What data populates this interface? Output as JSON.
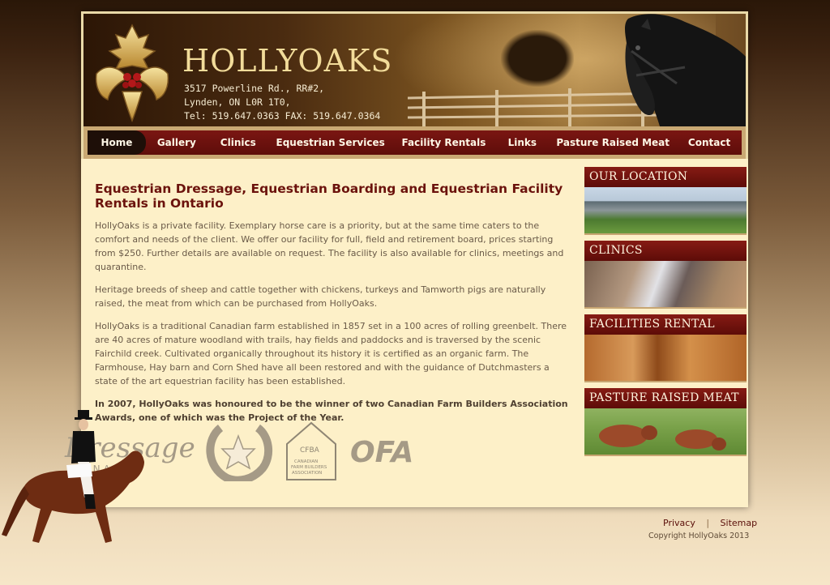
{
  "header": {
    "brand": "HOLLYOAKS",
    "address_line1": "3517 Powerline Rd., RR#2,",
    "address_line2": "Lynden, ON  L0R 1T0,",
    "contact_line": "Tel: 519.647.0363   FAX: 519.647.0364"
  },
  "nav": {
    "items": [
      {
        "label": "Home"
      },
      {
        "label": "Gallery"
      },
      {
        "label": "Clinics"
      },
      {
        "label": "Equestrian Services"
      },
      {
        "label": "Facility Rentals"
      },
      {
        "label": "Links"
      },
      {
        "label": "Pasture Raised Meat"
      },
      {
        "label": "Contact"
      }
    ],
    "active": "Home"
  },
  "main": {
    "title": "Equestrian Dressage, Equestrian Boarding and Equestrian Facility Rentals in Ontario",
    "paragraphs": [
      "HollyOaks is a private facility. Exemplary horse care is a priority, but at the same time caters to the comfort and needs of the client. We offer our facility for full, field and retirement board, prices starting from $250.  Further details are available on request. The facility is also available for clinics, meetings and quarantine.",
      "Heritage breeds of sheep and cattle together with chickens, turkeys and Tamworth pigs are naturally raised, the meat from which can be purchased from HollyOaks.",
      "HollyOaks is a traditional Canadian farm established in 1857 set in a 100 acres of rolling greenbelt. There are 40 acres of mature woodland with trails, hay fields and paddocks and is traversed by the scenic Fairchild creek. Cultivated organically throughout its history it is certified as an organic farm. The Farmhouse, Hay barn and Corn Shed have all been restored and with the guidance of Dutchmasters a state of the art equestrian facility has been established."
    ],
    "award": "In 2007, HollyOaks was honoured to be the winner of two Canadian Farm Builders Association Awards, one of which was the Project of the Year."
  },
  "logos": {
    "dressage_line1": "Dressage",
    "dressage_line2": "CANADA",
    "cfba_top": "CFBA",
    "cfba_line1": "CANADIAN",
    "cfba_line2": "FARM BUILDERS",
    "cfba_line3": "ASSOCIATION",
    "ofa": "OFA"
  },
  "sidebar": {
    "blocks": [
      {
        "heading": "OUR LOCATION"
      },
      {
        "heading": "CLINICS"
      },
      {
        "heading": "FACILITIES RENTAL"
      },
      {
        "heading": "PASTURE RAISED MEAT"
      }
    ]
  },
  "footer": {
    "privacy": "Privacy",
    "separator": "|",
    "sitemap": "Sitemap",
    "copyright": "Copyright HollyOaks 2013"
  },
  "colors": {
    "nav_red": "#6b120c",
    "page_bg": "#fdf0c8",
    "title_red": "#6b120c",
    "gold": "#f2dc9a"
  }
}
